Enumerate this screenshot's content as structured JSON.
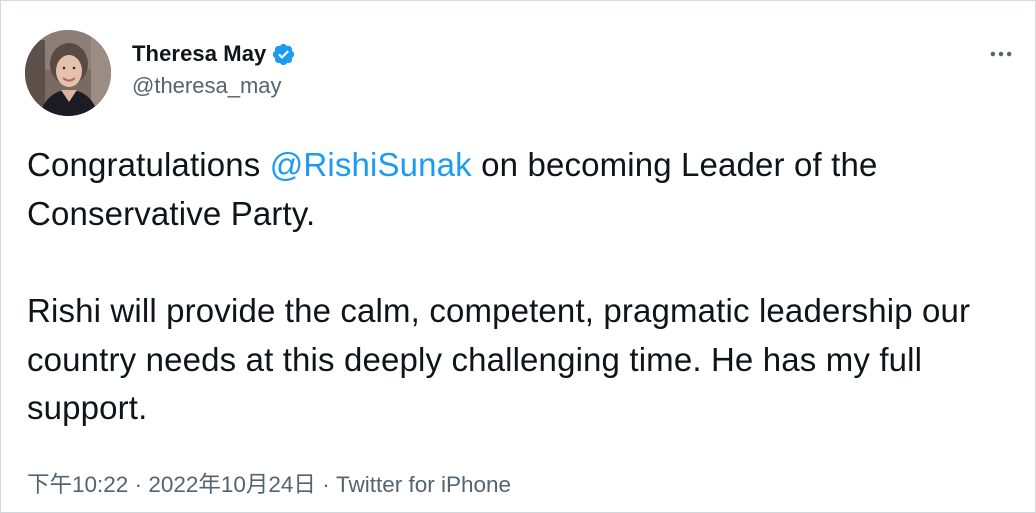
{
  "author": {
    "display_name": "Theresa May",
    "handle": "@theresa_may",
    "verified": true,
    "avatar_icon": "profile-photo"
  },
  "tweet": {
    "line1_before": "Congratulations ",
    "mention": "@RishiSunak",
    "line1_after": " on becoming Leader of the Conservative Party.",
    "paragraph2": "Rishi will provide the calm, competent, pragmatic leadership our country needs at this deeply challenging time. He has my full support."
  },
  "meta": {
    "time": "下午10:22",
    "separator": "·",
    "date": "2022年10月24日",
    "source": "Twitter for iPhone"
  },
  "icons": {
    "verified": "verified-badge-icon",
    "more": "more-options-icon"
  },
  "colors": {
    "accent": "#1d9bf0",
    "text": "#0f1419",
    "secondary": "#536471",
    "border": "#cfd9de"
  }
}
